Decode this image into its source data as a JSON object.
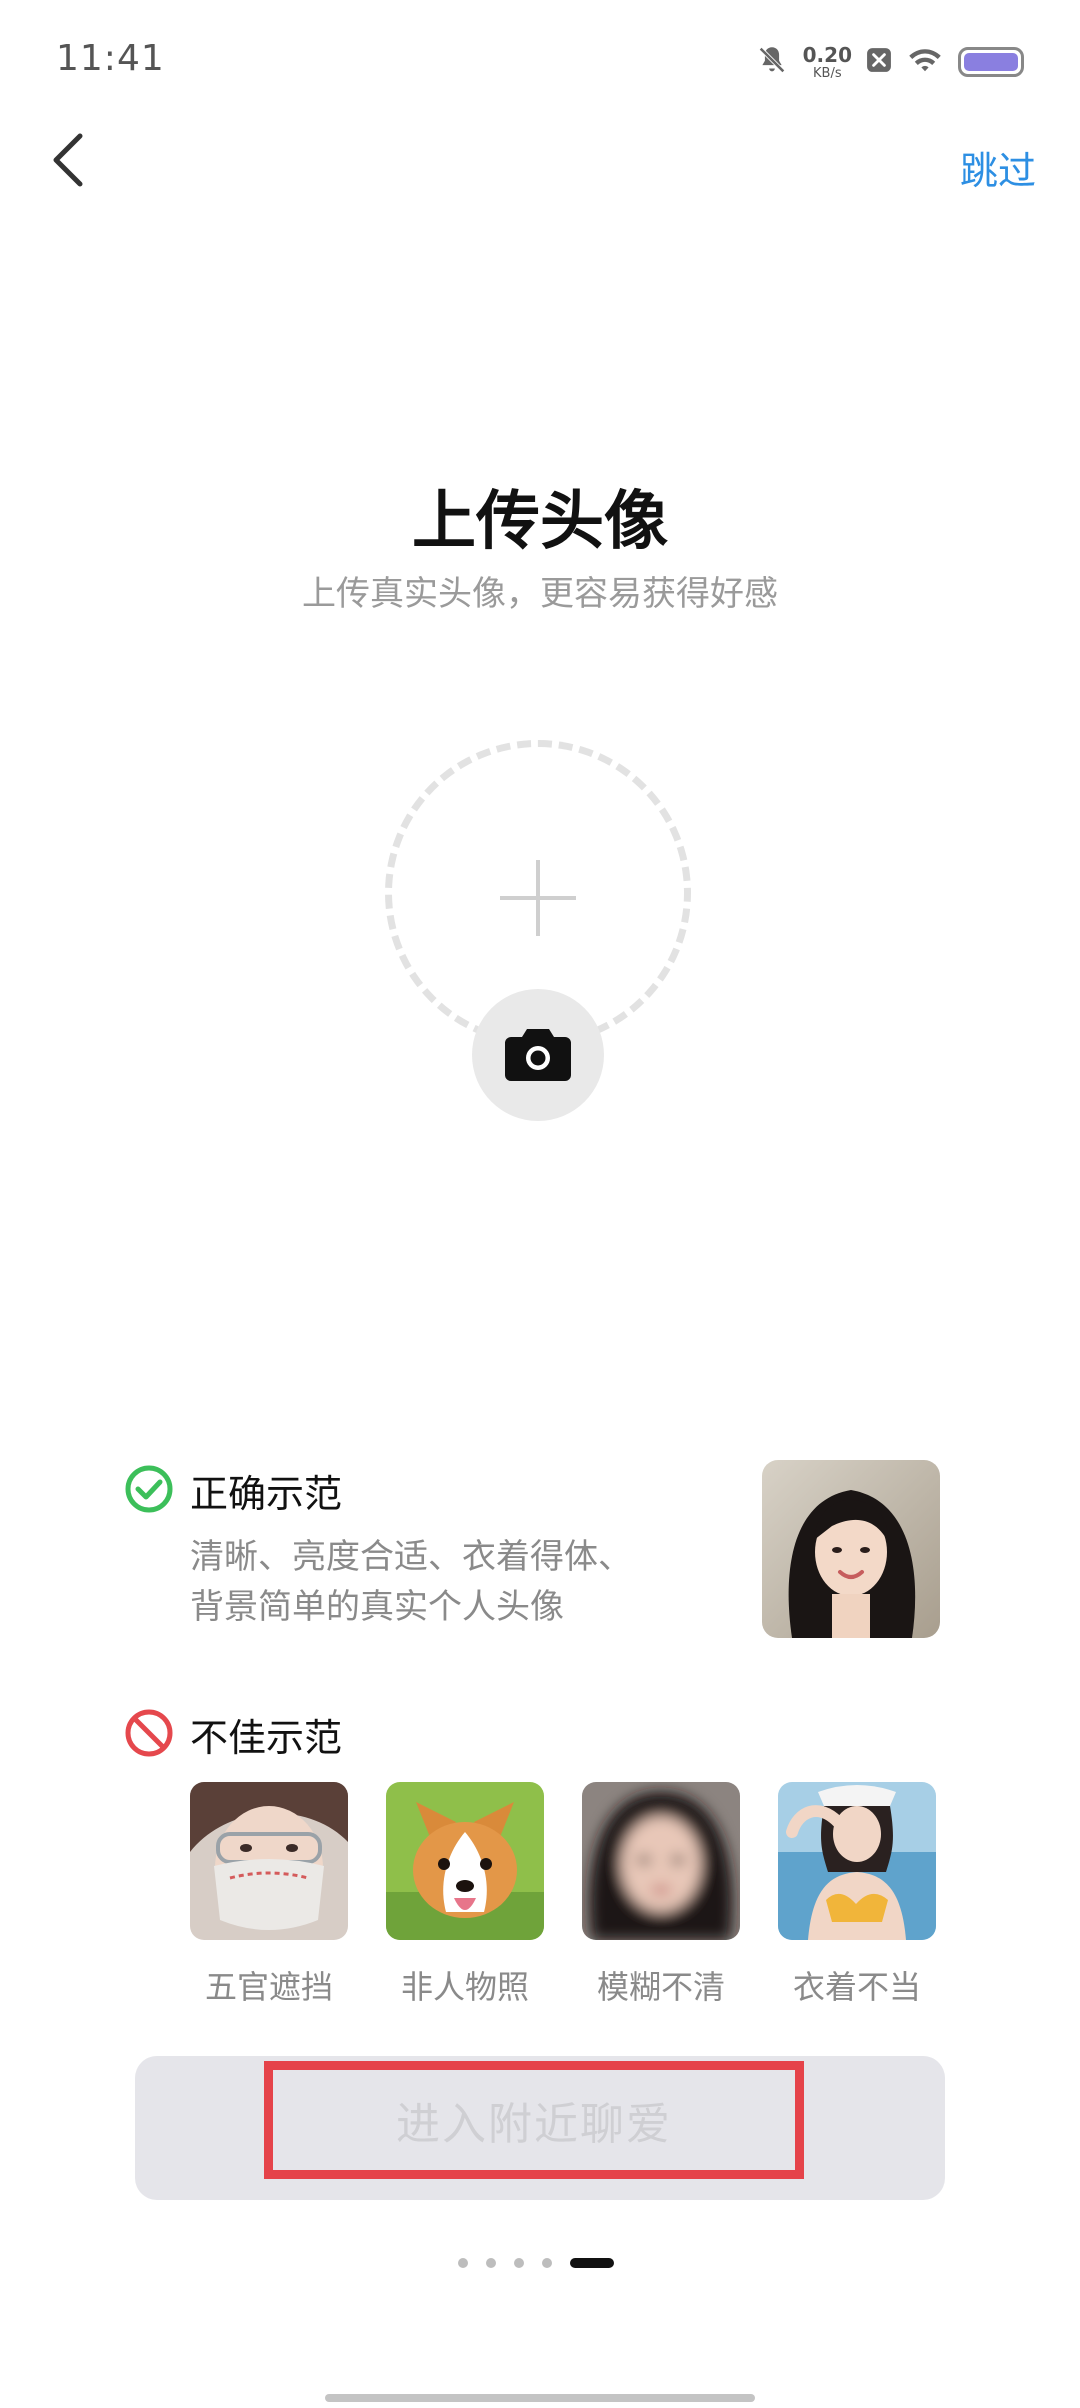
{
  "status_bar": {
    "time": "11:41",
    "net_speed_value": "0.20",
    "net_speed_unit": "KB/s",
    "icons": [
      "mute-bell-icon",
      "close-notification-icon",
      "wifi-icon",
      "battery-icon"
    ],
    "battery_color": "#8a7fe0"
  },
  "header": {
    "back_icon": "chevron-left-icon",
    "skip_label": "跳过",
    "skip_color": "#2d8fe3"
  },
  "main": {
    "title": "上传头像",
    "subtitle": "上传真实头像，更容易获得好感",
    "upload_icon": "plus-icon",
    "camera_icon": "camera-icon"
  },
  "good_example": {
    "icon": "check-circle-icon",
    "icon_color": "#3cbf5a",
    "title": "正确示范",
    "desc_line1": "清晰、亮度合适、衣着得体、",
    "desc_line2": "背景简单的真实个人头像"
  },
  "bad_examples": {
    "icon": "prohibited-icon",
    "icon_color": "#e5484d",
    "title": "不佳示范",
    "items": [
      {
        "label": "五官遮挡"
      },
      {
        "label": "非人物照"
      },
      {
        "label": "模糊不清"
      },
      {
        "label": "衣着不当"
      }
    ]
  },
  "enter_button": {
    "label": "进入附近聊爱",
    "highlight_color": "#e5434a"
  },
  "pagination": {
    "total": 5,
    "current": 5
  }
}
